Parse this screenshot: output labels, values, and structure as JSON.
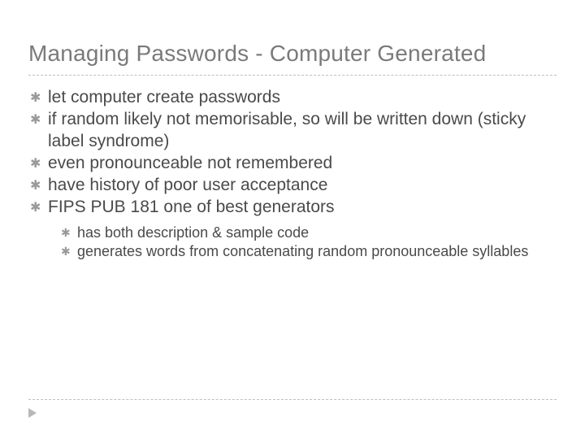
{
  "title": "Managing Passwords - Computer Generated",
  "bullet_glyph": "✱",
  "bullets": [
    {
      "text": "let computer create passwords"
    },
    {
      "text": "if random likely not memorisable, so will be written down (sticky label syndrome)"
    },
    {
      "text": "even pronounceable not remembered"
    },
    {
      "text": "have history of poor user acceptance"
    },
    {
      "text": "FIPS PUB 181 one of best generators"
    }
  ],
  "sub_bullets": [
    {
      "text": "has both description & sample code"
    },
    {
      "text": "generates words from concatenating random pronounceable syllables"
    }
  ]
}
